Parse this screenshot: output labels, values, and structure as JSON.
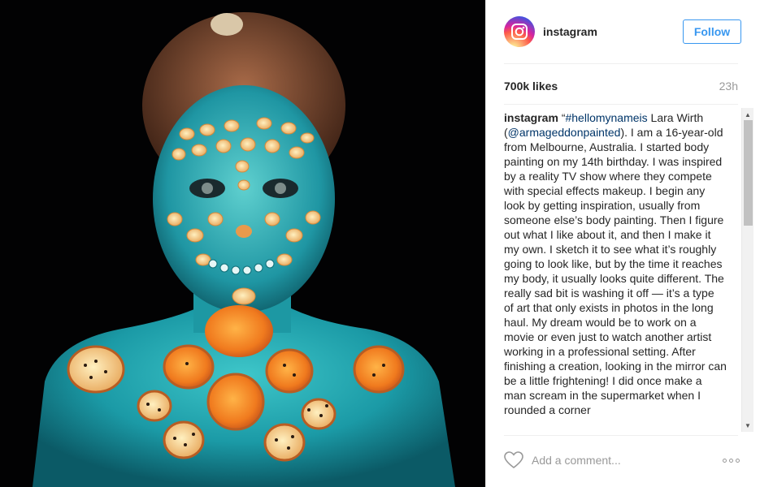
{
  "post": {
    "photo": {
      "description_icon": "photo"
    },
    "header": {
      "username": "instagram",
      "follow_label": "Follow",
      "avatar_icon": "instagram-logo-icon"
    },
    "stats": {
      "likes": "700k likes",
      "time": "23h"
    },
    "caption": {
      "username": "instagram",
      "quote_open": "“",
      "hashtag": "#hellomynameis",
      "text_1": " Lara Wirth (",
      "mention": "@armageddonpainted",
      "text_2": "). I am a 16-year-old from Melbourne, Australia. I started body painting on my 14th birthday. I was inspired by a reality TV show where they compete with special effects makeup. I begin any look by getting inspiration, usually from someone else’s body painting. Then I figure out what I like about it, and then I make it my own. I sketch it to see what it’s roughly going to look like, but by the time it reaches my body, it usually looks quite different. The really sad bit is washing it off — it’s a type of art that only exists in photos in the long haul. My dream would be to work on a movie or even just to watch another artist working in a professional setting. After finishing a creation, looking in the mirror can be a little frightening! I did once make a man scream in the supermarket when I rounded a corner"
    },
    "comment": {
      "placeholder": "Add a comment...",
      "heart_icon": "heart-outline-icon",
      "more_icon": "more-options-icon"
    },
    "colors": {
      "accent": "#3897f0",
      "text": "#262626",
      "muted": "#999999",
      "link": "#003569",
      "skin_paint": "#1fa5b0"
    }
  }
}
